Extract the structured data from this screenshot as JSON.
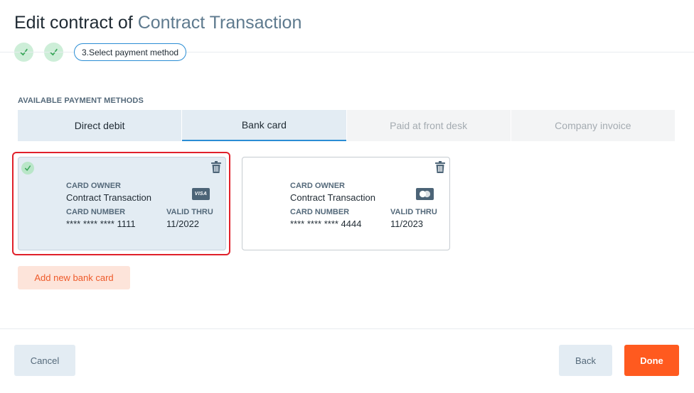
{
  "header": {
    "title_prefix": "Edit contract of ",
    "title_name": "Contract Transaction"
  },
  "stepper": {
    "steps": [
      {
        "state": "done",
        "icon": "check-icon"
      },
      {
        "state": "done",
        "icon": "check-icon"
      },
      {
        "state": "active",
        "label": "3.Select payment method"
      }
    ]
  },
  "payment": {
    "section_label": "AVAILABLE PAYMENT METHODS",
    "tabs": [
      {
        "label": "Direct debit",
        "state": "enabled"
      },
      {
        "label": "Bank card",
        "state": "active"
      },
      {
        "label": "Paid at front desk",
        "state": "disabled"
      },
      {
        "label": "Company invoice",
        "state": "disabled"
      }
    ]
  },
  "cards": [
    {
      "selected": true,
      "owner_label": "CARD OWNER",
      "owner": "Contract Transaction",
      "number_label": "CARD NUMBER",
      "number": "**** **** **** 1111",
      "valid_label": "VALID THRU",
      "valid": "11/2022",
      "brand": "VISA",
      "brand_icon": "visa-icon"
    },
    {
      "selected": false,
      "owner_label": "CARD OWNER",
      "owner": "Contract Transaction",
      "number_label": "CARD NUMBER",
      "number": "**** **** **** 4444",
      "valid_label": "VALID THRU",
      "valid": "11/2023",
      "brand_icon": "mastercard-icon"
    }
  ],
  "actions": {
    "add_card": "Add new bank card",
    "cancel": "Cancel",
    "back": "Back",
    "done": "Done"
  },
  "colors": {
    "accent": "#2a8dd4",
    "primary_button": "#ff5a1f",
    "selection_outline": "#e0202a",
    "success": "#cdeed8"
  }
}
